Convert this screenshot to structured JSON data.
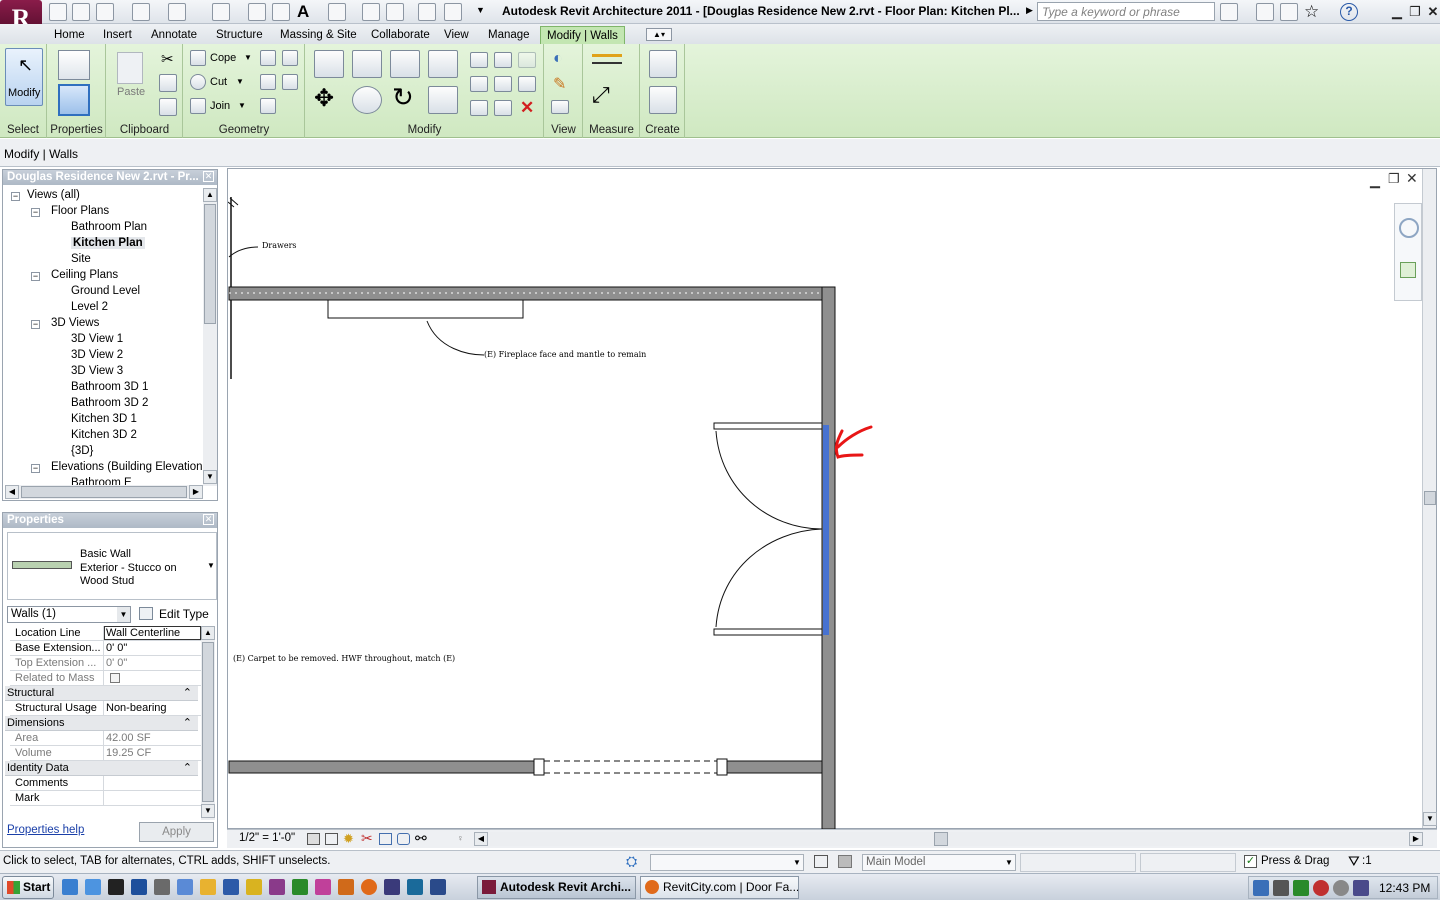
{
  "app": {
    "logo_letter": "R",
    "title": "Autodesk Revit Architecture 2011 - [Douglas Residence New 2.rvt - Floor Plan: Kitchen Pl...",
    "search_placeholder": "Type a keyword or phrase"
  },
  "tabs": [
    "Home",
    "Insert",
    "Annotate",
    "Structure",
    "Massing & Site",
    "Collaborate",
    "View",
    "Manage",
    "Modify | Walls"
  ],
  "ribbon": {
    "modify_label": "Modify",
    "paste_label": "Paste",
    "cope_label": "Cope",
    "cut_label": "Cut",
    "join_label": "Join",
    "panels": [
      "Select",
      "Properties",
      "Clipboard",
      "Geometry",
      "Modify",
      "View",
      "Measure",
      "Create"
    ]
  },
  "options_bar": {
    "context": "Modify | Walls"
  },
  "project_browser": {
    "title": "Douglas Residence New 2.rvt - Pr...",
    "items": [
      {
        "label": "Views (all)",
        "level": 0,
        "expander": "−"
      },
      {
        "label": "Floor Plans",
        "level": 1,
        "expander": "−"
      },
      {
        "label": "Bathroom Plan",
        "level": 2
      },
      {
        "label": "Kitchen Plan",
        "level": 2,
        "selected": true
      },
      {
        "label": "Site",
        "level": 2
      },
      {
        "label": "Ceiling Plans",
        "level": 1,
        "expander": "−"
      },
      {
        "label": "Ground Level",
        "level": 2
      },
      {
        "label": "Level 2",
        "level": 2
      },
      {
        "label": "3D Views",
        "level": 1,
        "expander": "−"
      },
      {
        "label": "3D View 1",
        "level": 2
      },
      {
        "label": "3D View 2",
        "level": 2
      },
      {
        "label": "3D View 3",
        "level": 2
      },
      {
        "label": "Bathroom 3D 1",
        "level": 2
      },
      {
        "label": "Bathroom 3D 2",
        "level": 2
      },
      {
        "label": "Kitchen 3D 1",
        "level": 2
      },
      {
        "label": "Kitchen 3D 2",
        "level": 2
      },
      {
        "label": "{3D}",
        "level": 2
      },
      {
        "label": "Elevations (Building Elevation",
        "level": 1,
        "expander": "−"
      },
      {
        "label": "Bathroom E",
        "level": 2
      }
    ]
  },
  "properties": {
    "title": "Properties",
    "type_name": "Basic Wall",
    "type_detail": "Exterior - Stucco on Wood Stud",
    "selector": "Walls (1)",
    "edit_type": "Edit Type",
    "rows": [
      {
        "kind": "row",
        "label": "Location Line",
        "value": "Wall Centerline",
        "editable": true
      },
      {
        "kind": "row",
        "label": "Base Extension...",
        "value": "0'  0\""
      },
      {
        "kind": "row",
        "label": "Top Extension ...",
        "value": "0'  0\"",
        "dim": true
      },
      {
        "kind": "check",
        "label": "Related to Mass",
        "dim": true
      },
      {
        "kind": "group",
        "label": "Structural"
      },
      {
        "kind": "row",
        "label": "Structural Usage",
        "value": "Non-bearing"
      },
      {
        "kind": "group",
        "label": "Dimensions"
      },
      {
        "kind": "row",
        "label": "Area",
        "value": "42.00 SF",
        "dim": true
      },
      {
        "kind": "row",
        "label": "Volume",
        "value": "19.25 CF",
        "dim": true
      },
      {
        "kind": "group",
        "label": "Identity Data"
      },
      {
        "kind": "row",
        "label": "Comments",
        "value": ""
      },
      {
        "kind": "row",
        "label": "Mark",
        "value": ""
      }
    ],
    "help_link": "Properties help",
    "apply": "Apply"
  },
  "drawing": {
    "note_drawers": "Drawers",
    "note_fireplace": "(E) Fireplace face and mantle to remain",
    "note_carpet": "(E) Carpet to be removed. HWF throughout, match (E)"
  },
  "view_bar": {
    "scale": "1/2\" = 1'-0\""
  },
  "status_bar": {
    "hint": "Click to select, TAB for alternates, CTRL adds, SHIFT unselects.",
    "workset": "Main Model",
    "press_drag": "Press & Drag",
    "filter_count": ":1"
  },
  "taskbar": {
    "start": "Start",
    "items": [
      "Autodesk Revit Archi...",
      "RevitCity.com | Door Fa..."
    ],
    "clock": "12:43 PM"
  },
  "colors": {
    "ribbon_green": "#cfe8c1",
    "selection_blue": "#3f6fd8",
    "markup_red": "#e81616"
  }
}
